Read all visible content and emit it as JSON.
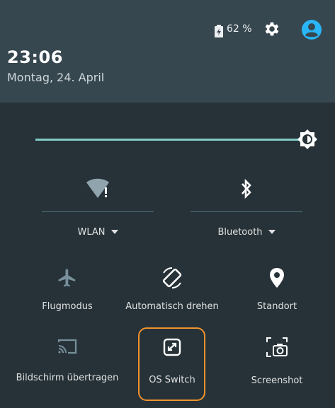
{
  "status": {
    "battery_text": "62 %"
  },
  "clock": {
    "time": "23:06",
    "date": "Montag, 24. April"
  },
  "brightness": {
    "level": 0.95
  },
  "tiles_top": [
    {
      "label": "WLAN",
      "icon": "wifi-off-icon"
    },
    {
      "label": "Bluetooth",
      "icon": "bluetooth-icon"
    }
  ],
  "tiles": [
    {
      "label": "Flugmodus",
      "icon": "airplane-icon"
    },
    {
      "label": "Automatisch drehen",
      "icon": "auto-rotate-icon"
    },
    {
      "label": "Standort",
      "icon": "location-icon"
    },
    {
      "label": "Bildschirm übertragen",
      "icon": "cast-icon"
    },
    {
      "label": "OS Switch",
      "icon": "os-switch-icon"
    },
    {
      "label": "Screenshot",
      "icon": "screenshot-icon"
    }
  ],
  "colors": {
    "header": "#37474f",
    "panel": "#263238",
    "accent": "#80cbc4",
    "highlight": "#f0922e",
    "account": "#29b6f6"
  }
}
